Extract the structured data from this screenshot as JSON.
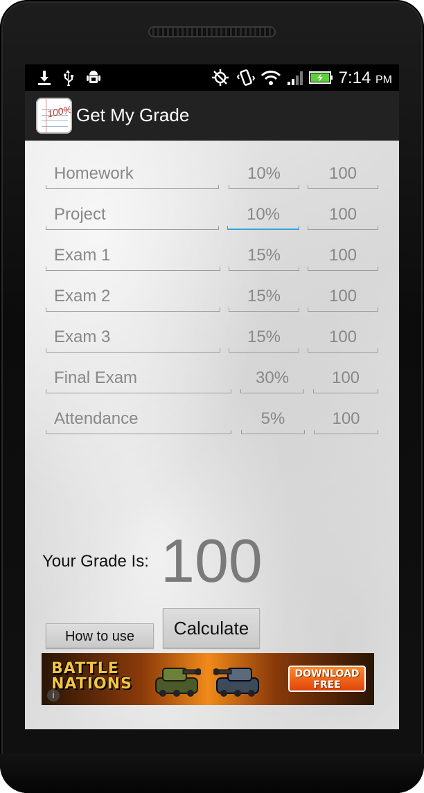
{
  "status_bar": {
    "time": "7:14",
    "ampm": "PM",
    "icons": [
      "download-icon",
      "usb-icon",
      "android-debug-icon",
      "gps-icon",
      "vibrate-icon",
      "wifi-icon",
      "signal-icon",
      "battery-charging-icon"
    ]
  },
  "app": {
    "title": "Get My Grade"
  },
  "rows": [
    {
      "name": "Homework",
      "weight": "10%",
      "score": "100"
    },
    {
      "name": "Project",
      "weight": "10%",
      "score": "100"
    },
    {
      "name": "Exam 1",
      "weight": "15%",
      "score": "100"
    },
    {
      "name": "Exam 2",
      "weight": "15%",
      "score": "100"
    },
    {
      "name": "Exam 3",
      "weight": "15%",
      "score": "100"
    },
    {
      "name": "Final Exam",
      "weight": "30%",
      "score": "100"
    },
    {
      "name": "Attendance",
      "weight": "5%",
      "score": "100"
    }
  ],
  "result": {
    "label": "Your Grade Is:",
    "value": "100"
  },
  "buttons": {
    "how_to_use": "How to use",
    "calculate": "Calculate"
  },
  "ad": {
    "logo_line1": "BATTLE",
    "logo_line2": "NATIONS",
    "cta_line1": "DOWNLOAD",
    "cta_line2": "FREE"
  },
  "colors": {
    "focus_underline": "#33a3d8",
    "action_bar": "#222222",
    "grade_value": "#7a7a7a"
  }
}
